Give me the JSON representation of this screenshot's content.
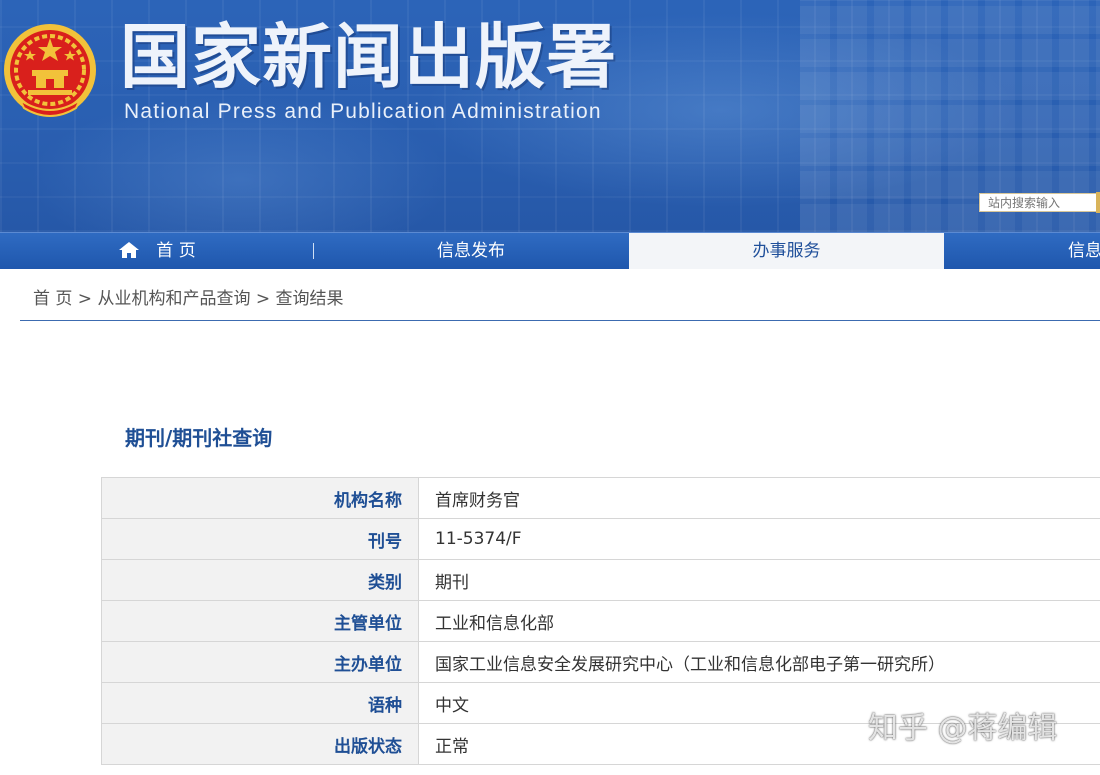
{
  "header": {
    "title": "国家新闻出版署",
    "subtitle": "National  Press and Publication Administration",
    "search_placeholder": "站内搜索输入"
  },
  "nav": {
    "items": [
      {
        "label": "首 页",
        "icon": "home-icon"
      },
      {
        "label": "信息发布"
      },
      {
        "label": "办事服务",
        "active": true
      },
      {
        "label": "信息"
      }
    ]
  },
  "breadcrumb": {
    "items": [
      "首 页",
      "从业机构和产品查询",
      "查询结果"
    ],
    "separator": " > "
  },
  "main": {
    "section_title": "期刊/期刊社查询",
    "rows": [
      {
        "label": "机构名称",
        "value": "首席财务官"
      },
      {
        "label": "刊号",
        "value": "11-5374/F"
      },
      {
        "label": "类别",
        "value": "期刊"
      },
      {
        "label": "主管单位",
        "value": "工业和信息化部"
      },
      {
        "label": "主办单位",
        "value": "国家工业信息安全发展研究中心（工业和信息化部电子第一研究所）"
      },
      {
        "label": "语种",
        "value": "中文"
      },
      {
        "label": "出版状态",
        "value": "正常"
      }
    ]
  },
  "watermark": "知乎 @蒋编辑",
  "colors": {
    "header_blue": "#2a5fb1",
    "nav_blue": "#1f57ad",
    "label_blue": "#1f4f95",
    "emblem_red": "#d9201c",
    "emblem_gold": "#f2c23a"
  }
}
